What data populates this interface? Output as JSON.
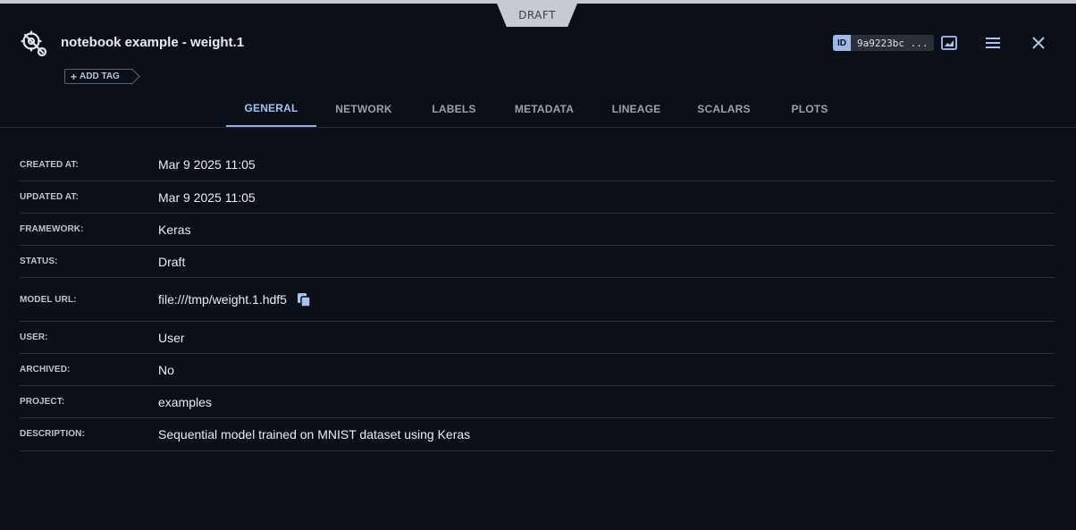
{
  "status_badge": "DRAFT",
  "header": {
    "title": "notebook example - weight.1",
    "add_tag_label": "ADD TAG",
    "id_label": "ID",
    "id_value": "9a9223bc ...",
    "icons": [
      "model-icon",
      "chart-icon",
      "menu-icon",
      "close-icon"
    ]
  },
  "tabs": [
    {
      "label": "GENERAL",
      "active": true
    },
    {
      "label": "NETWORK",
      "active": false
    },
    {
      "label": "LABELS",
      "active": false
    },
    {
      "label": "METADATA",
      "active": false
    },
    {
      "label": "LINEAGE",
      "active": false
    },
    {
      "label": "SCALARS",
      "active": false
    },
    {
      "label": "PLOTS",
      "active": false
    }
  ],
  "details": [
    {
      "label": "CREATED AT:",
      "value": "Mar 9 2025 11:05"
    },
    {
      "label": "UPDATED AT:",
      "value": "Mar 9 2025 11:05"
    },
    {
      "label": "FRAMEWORK:",
      "value": "Keras"
    },
    {
      "label": "STATUS:",
      "value": "Draft"
    },
    {
      "label": "MODEL URL:",
      "value": "file:///tmp/weight.1.hdf5"
    },
    {
      "label": "USER:",
      "value": "User"
    },
    {
      "label": "ARCHIVED:",
      "value": "No"
    },
    {
      "label": "PROJECT:",
      "value": "examples"
    },
    {
      "label": "DESCRIPTION:",
      "value": "Sequential model trained on MNIST dataset using Keras"
    }
  ],
  "colors": {
    "background": "#0b0f17",
    "accent": "#8eb0ee",
    "divider": "#2b303a"
  }
}
